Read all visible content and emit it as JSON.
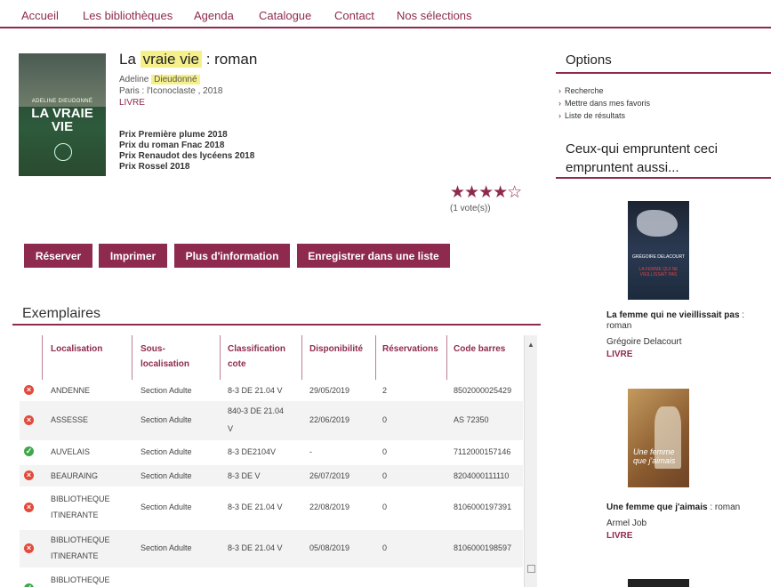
{
  "nav": [
    "Accueil",
    "Les bibliothèques",
    "Agenda",
    "Catalogue",
    "Contact",
    "Nos sélections"
  ],
  "book": {
    "cover": {
      "author": "ADELINE DIEUDONNÉ",
      "title_line1": "LA VRAIE",
      "title_line2": "VIE"
    },
    "title_pre": "La",
    "title_hl": "vraie  vie",
    "title_post": ": roman",
    "author_first": "Adeline",
    "author_last": "Dieudonné",
    "publisher": "Paris : l'Iconoclaste , 2018",
    "type": "LIVRE",
    "prizes": [
      "Prix Première plume 2018",
      "Prix du roman Fnac 2018",
      "Prix Renaudot des lycéens 2018",
      "Prix Rossel 2018"
    ],
    "rating": 4,
    "rating_max": 5,
    "stars_text": "★★★★☆",
    "votes": "(1 vote(s))"
  },
  "buttons": [
    "Réserver",
    "Imprimer",
    "Plus d'information",
    "Enregistrer dans une liste"
  ],
  "exemplaires": {
    "title": "Exemplaires",
    "headers": [
      {
        "l1": "Localisation",
        "l2": ""
      },
      {
        "l1": "Sous-",
        "l2": "localisation"
      },
      {
        "l1": "Classification",
        "l2": "cote"
      },
      {
        "l1": "Disponibilité",
        "l2": ""
      },
      {
        "l1": "Réservations",
        "l2": ""
      },
      {
        "l1": "Code barres",
        "l2": ""
      }
    ],
    "rows": [
      {
        "status": "unavailable",
        "loc1": "ANDENNE",
        "loc2": "",
        "sub": "Section Adulte",
        "class1": "8-3 DE 21.04 V",
        "class2": "",
        "dispo": "29/05/2019",
        "resa": "2",
        "code": "8502000025429"
      },
      {
        "status": "unavailable",
        "loc1": "ASSESSE",
        "loc2": "",
        "sub": "Section Adulte",
        "class1": "840-3 DE 21.04",
        "class2": "V",
        "dispo": "22/06/2019",
        "resa": "0",
        "code": "AS 72350"
      },
      {
        "status": "available",
        "loc1": "AUVELAIS",
        "loc2": "",
        "sub": "Section Adulte",
        "class1": "8-3 DE2104V",
        "class2": "",
        "dispo": "-",
        "resa": "0",
        "code": "7112000157146"
      },
      {
        "status": "unavailable",
        "loc1": "BEAURAING",
        "loc2": "",
        "sub": "Section Adulte",
        "class1": "8-3 DE V",
        "class2": "",
        "dispo": "26/07/2019",
        "resa": "0",
        "code": "8204000111110"
      },
      {
        "status": "unavailable",
        "loc1": "BIBLIOTHEQUE",
        "loc2": "ITINERANTE",
        "sub": "Section Adulte",
        "class1": "8-3 DE 21.04 V",
        "class2": "",
        "dispo": "22/08/2019",
        "resa": "0",
        "code": "8106000197391"
      },
      {
        "status": "unavailable",
        "loc1": "BIBLIOTHEQUE",
        "loc2": "ITINERANTE",
        "sub": "Section Adulte",
        "class1": "8-3 DE 21.04 V",
        "class2": "",
        "dispo": "05/08/2019",
        "resa": "0",
        "code": "8106000198597"
      },
      {
        "status": "available",
        "loc1": "BIBLIOTHEQUE",
        "loc2": "",
        "sub": "",
        "class1": "",
        "class2": "",
        "dispo": "",
        "resa": "",
        "code": ""
      }
    ]
  },
  "sidebar": {
    "options_title": "Options",
    "options": [
      "Recherche",
      "Mettre dans mes favoris",
      "Liste de résultats"
    ],
    "also_title": "Ceux-qui empruntent ceci empruntent aussi...",
    "suggestions": [
      {
        "cover_author": "GRÉGOIRE DELACOURT",
        "cover_title": "LA FEMME QUI NE VIEILLISSAIT PAS",
        "title": "La femme qui ne vieillissait pas",
        "subtitle": ": roman",
        "author": "Grégoire Delacourt",
        "type": "LIVRE"
      },
      {
        "cover_title": "Une femme que j'aimais",
        "title": "Une femme que j'aimais",
        "subtitle": ": roman",
        "author": "Armel Job",
        "type": "LIVRE"
      }
    ]
  },
  "colors": {
    "accent": "#8f2a4f",
    "unavailable": "#e24a3b",
    "available": "#3fa84a"
  }
}
